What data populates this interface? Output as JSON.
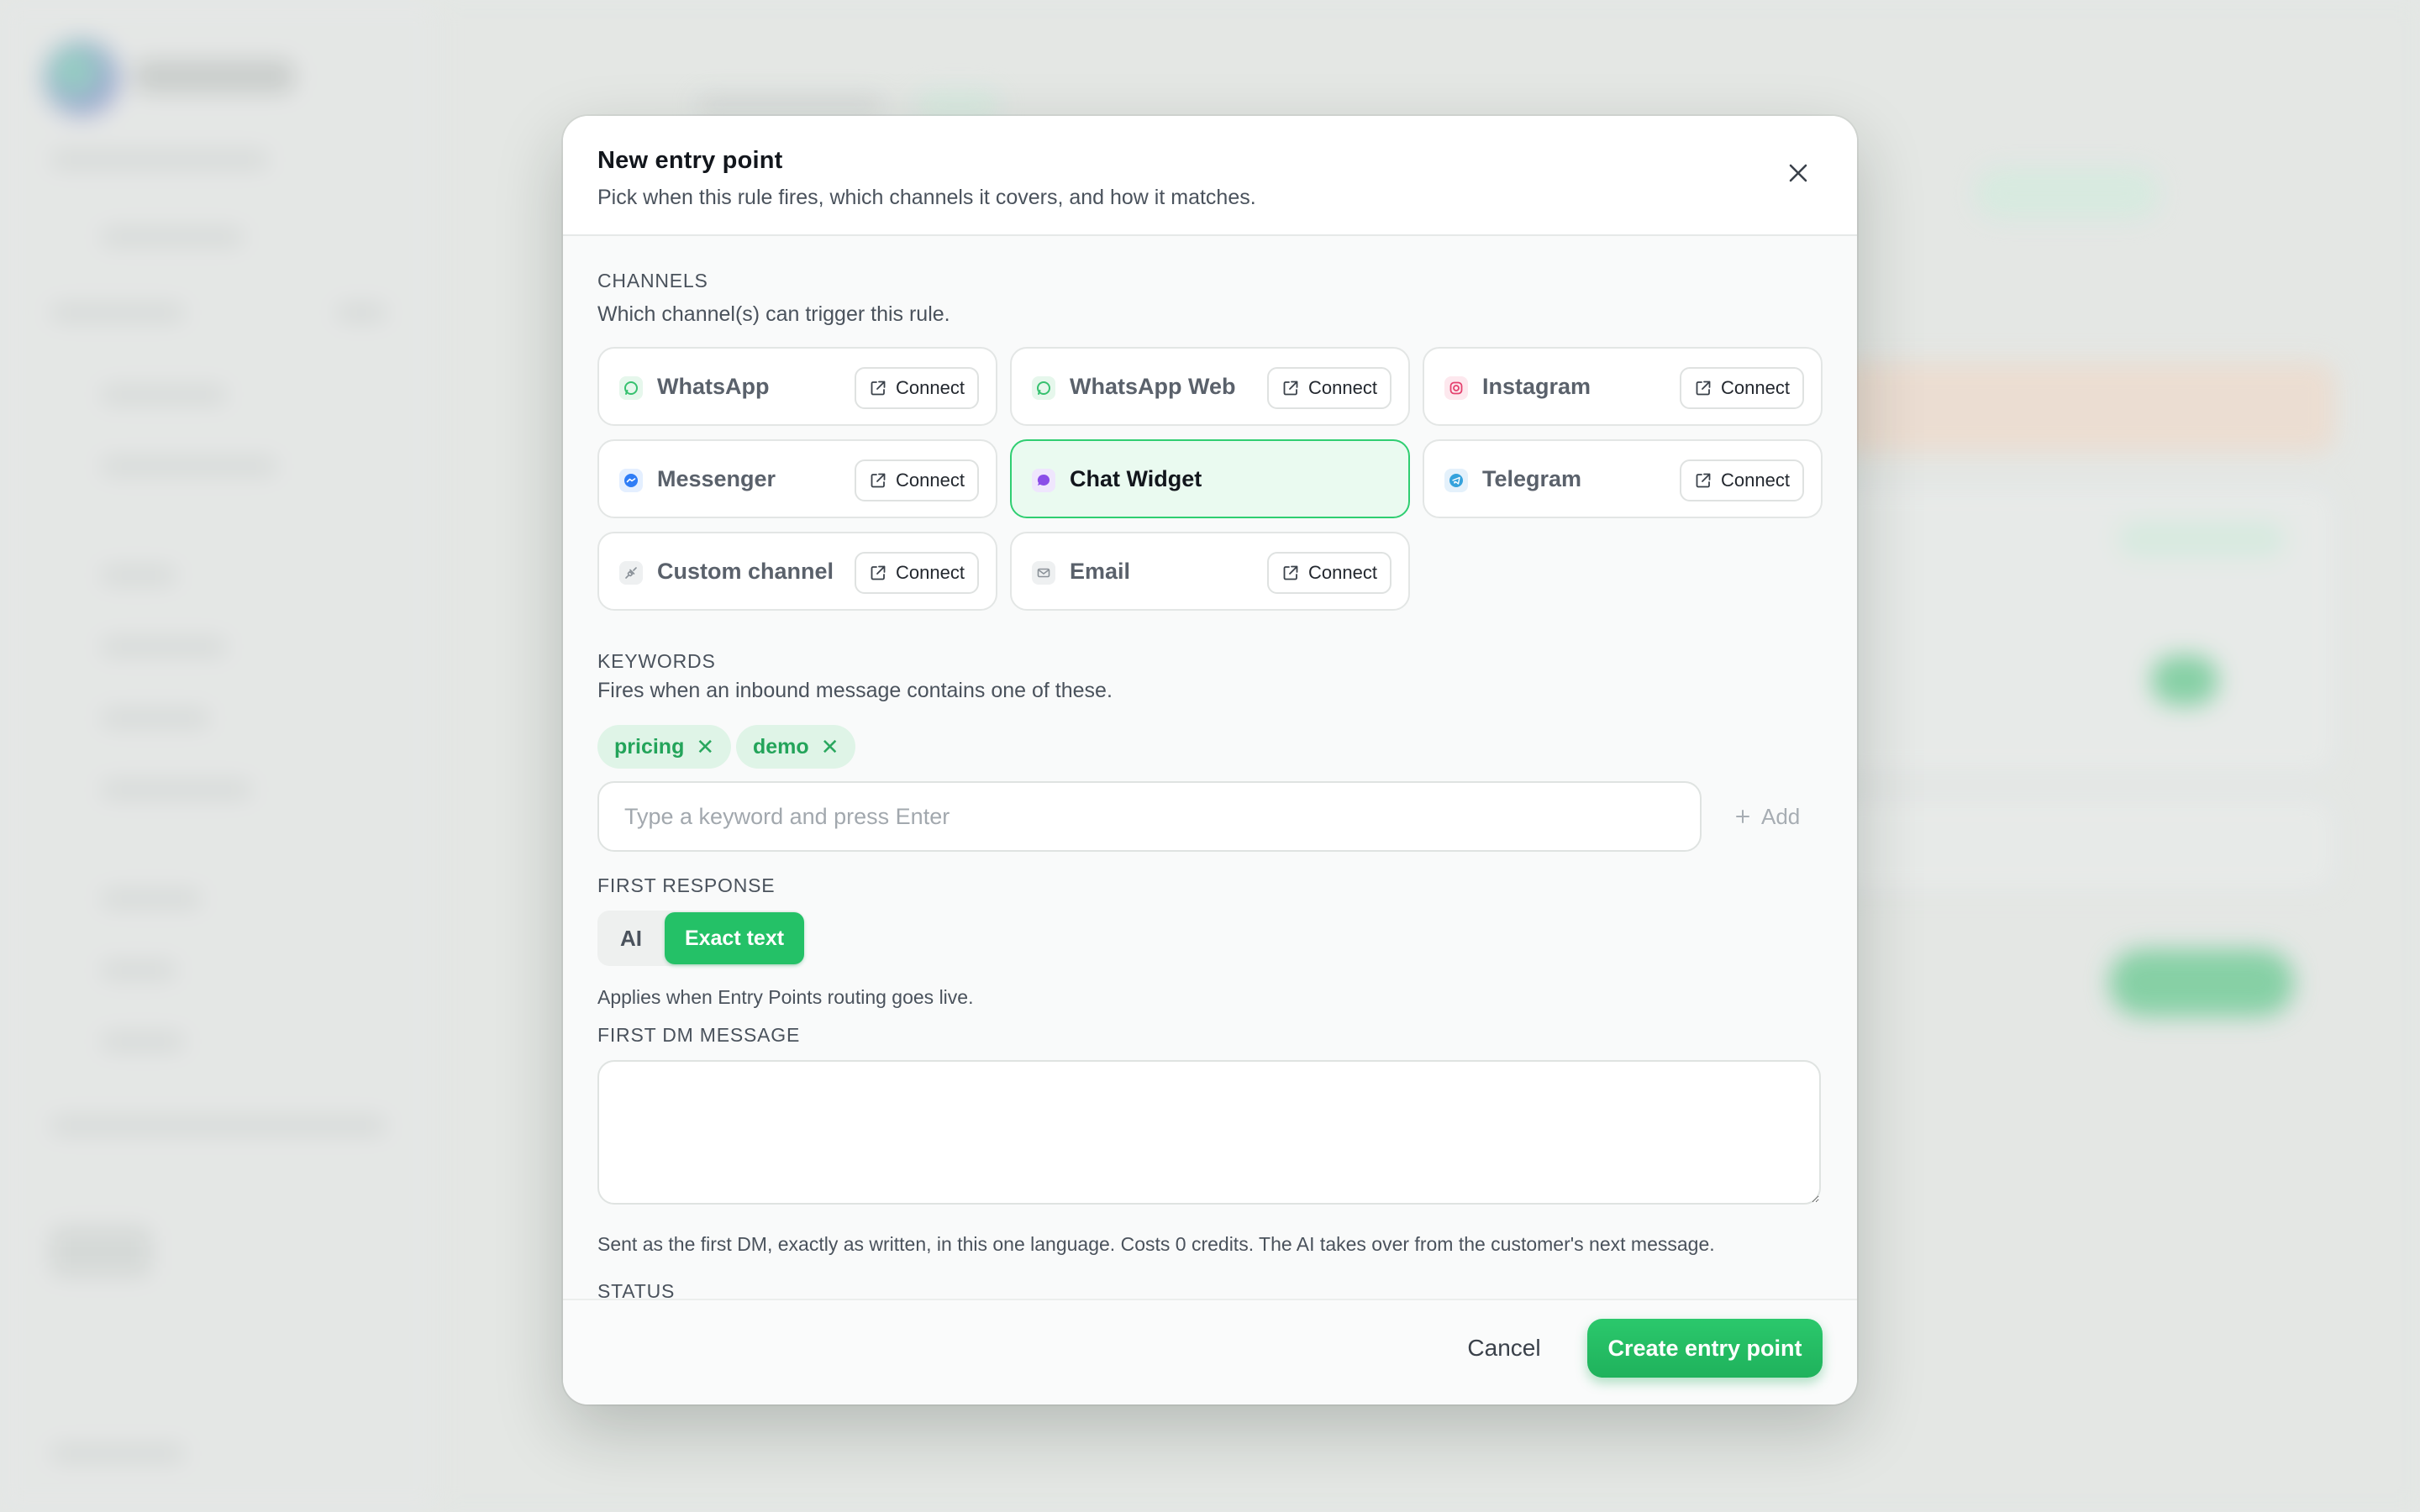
{
  "modal": {
    "title": "New entry point",
    "subtitle": "Pick when this rule fires, which channels it covers, and how it matches."
  },
  "channels": {
    "label": "CHANNELS",
    "description": "Which channel(s) can trigger this rule.",
    "connect_label": "Connect",
    "items": [
      {
        "name": "WhatsApp",
        "icon": "whatsapp-icon",
        "selected": false
      },
      {
        "name": "WhatsApp Web",
        "icon": "whatsapp-web-icon",
        "selected": false
      },
      {
        "name": "Instagram",
        "icon": "instagram-icon",
        "selected": false
      },
      {
        "name": "Messenger",
        "icon": "messenger-icon",
        "selected": false
      },
      {
        "name": "Chat Widget",
        "icon": "chat-widget-icon",
        "selected": true
      },
      {
        "name": "Telegram",
        "icon": "telegram-icon",
        "selected": false
      },
      {
        "name": "Custom channel",
        "icon": "plug-icon",
        "selected": false
      },
      {
        "name": "Email",
        "icon": "email-icon",
        "selected": false
      }
    ]
  },
  "keywords": {
    "label": "KEYWORDS",
    "description": "Fires when an inbound message contains one of these.",
    "tags": [
      "pricing",
      "demo"
    ],
    "input_placeholder": "Type a keyword and press Enter",
    "input_value": "",
    "add_label": "Add"
  },
  "first_response": {
    "label": "FIRST RESPONSE",
    "options": [
      "AI",
      "Exact text"
    ],
    "selected": "Exact text",
    "note": "Applies when Entry Points routing goes live."
  },
  "first_dm": {
    "label": "FIRST DM MESSAGE",
    "value": "",
    "note": "Sent as the first DM, exactly as written, in this one language. Costs 0 credits. The AI takes over from the customer's next message."
  },
  "status": {
    "label": "STATUS"
  },
  "footer": {
    "cancel_label": "Cancel",
    "create_label": "Create entry point"
  },
  "colors": {
    "accent": "#24c167",
    "selected_card_bg": "#eafaf0",
    "tag_bg": "#dff4e7",
    "tag_text": "#23a45a"
  }
}
